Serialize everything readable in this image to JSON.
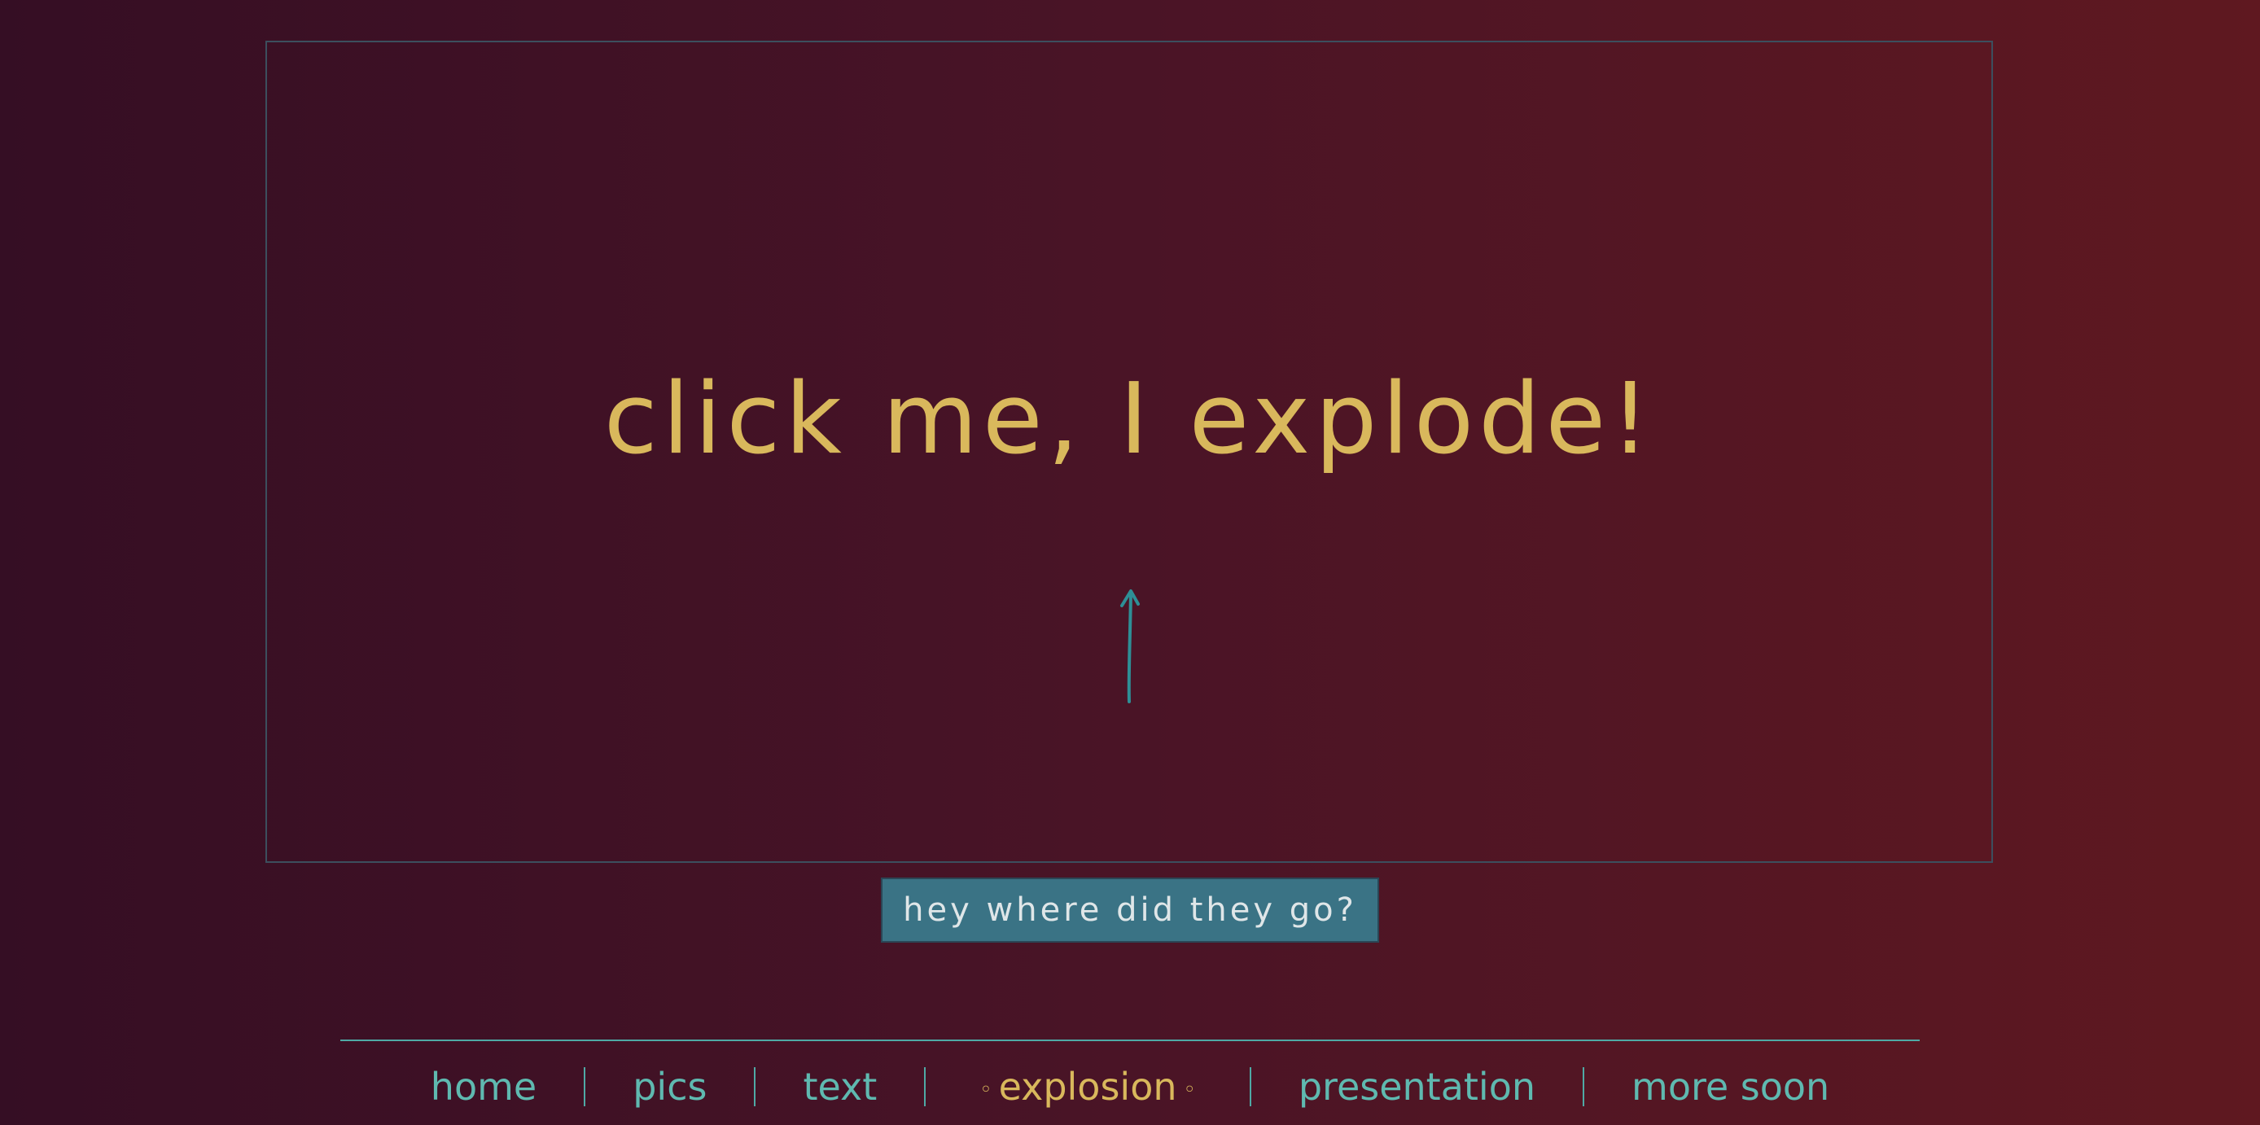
{
  "stage": {
    "headline": "click me, I explode!"
  },
  "reset_button": {
    "label": "hey where did they go?"
  },
  "nav": {
    "items": [
      {
        "label": "home",
        "current": false
      },
      {
        "label": "pics",
        "current": false
      },
      {
        "label": "text",
        "current": false
      },
      {
        "label": "explosion",
        "current": true
      },
      {
        "label": "presentation",
        "current": false
      },
      {
        "label": "more soon",
        "current": false
      }
    ],
    "current_marker": "◦"
  },
  "colors": {
    "accent_gold": "#d9b85c",
    "accent_teal": "#5fb9b0",
    "button_bg": "#3a7385",
    "background_start": "#350e24",
    "background_end": "#5f1820"
  },
  "icons": {
    "arrow": "arrow-up-icon"
  }
}
